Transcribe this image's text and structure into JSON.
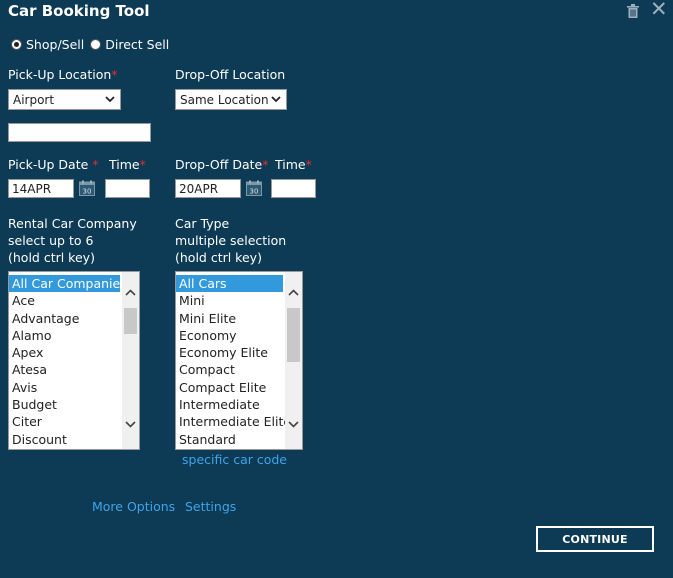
{
  "header": {
    "title": "Car Booking Tool"
  },
  "mode": {
    "options": [
      {
        "label": "Shop/Sell",
        "checked": true
      },
      {
        "label": "Direct Sell",
        "checked": false
      }
    ]
  },
  "pickup_location": {
    "label": "Pick-Up Location",
    "required_mark": "*",
    "value": "Airport",
    "text_value": ""
  },
  "dropoff_location": {
    "label": "Drop-Off Location",
    "value": "Same Location"
  },
  "pickup_date": {
    "label": "Pick-Up Date",
    "required_mark": "*",
    "value": "14APR",
    "calendar_day": "30"
  },
  "pickup_time": {
    "label": "Time",
    "required_mark": "*",
    "value": ""
  },
  "dropoff_date": {
    "label": "Drop-Off Date",
    "required_mark": "*",
    "value": "20APR",
    "calendar_day": "30"
  },
  "dropoff_time": {
    "label": "Time",
    "required_mark": "*",
    "value": ""
  },
  "companies": {
    "label_lines": [
      "Rental Car Company",
      "select up to 6",
      "(hold ctrl key)"
    ],
    "items": [
      "All Car Companies",
      "Ace",
      "Advantage",
      "Alamo",
      "Apex",
      "Atesa",
      "Avis",
      "Budget",
      "Citer",
      "Discount"
    ],
    "selected_index": 0
  },
  "car_types": {
    "label_lines": [
      "Car Type",
      "multiple selection",
      "(hold ctrl key)"
    ],
    "items": [
      "All Cars",
      "Mini",
      "Mini Elite",
      "Economy",
      "Economy Elite",
      "Compact",
      "Compact Elite",
      "Intermediate",
      "Intermediate Elite",
      "Standard"
    ],
    "selected_index": 0
  },
  "links": {
    "specific_code": "specific car code",
    "more_options": "More Options",
    "settings": "Settings"
  },
  "actions": {
    "continue": "CONTINUE"
  },
  "colors": {
    "background": "#0d3a55",
    "accent": "#3399dd",
    "link": "#3fa4e8",
    "required": "#e0302e"
  }
}
